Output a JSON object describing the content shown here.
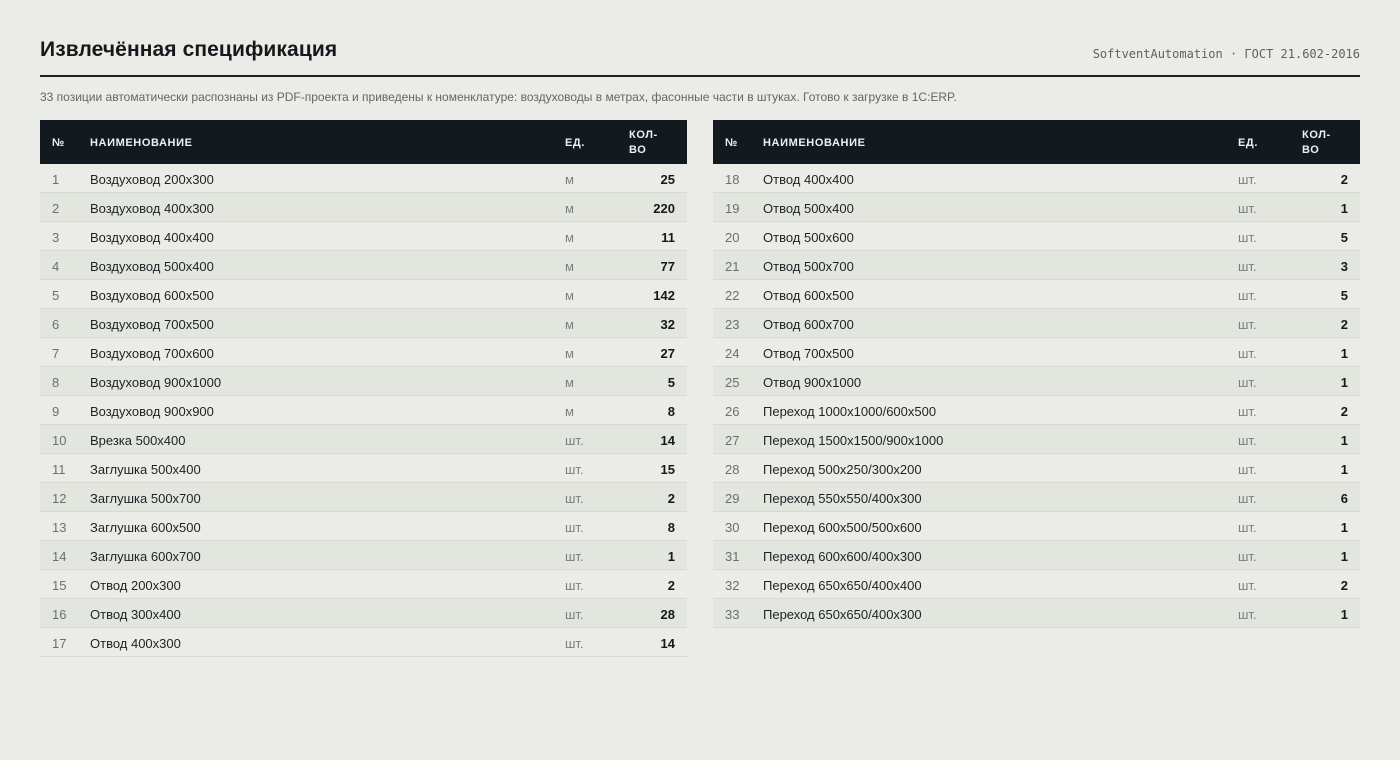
{
  "header": {
    "title": "Извлечённая спецификация",
    "meta": "SoftventAutomation · ГОСТ 21.602-2016"
  },
  "subtitle": "33 позиции автоматически распознаны из PDF-проекта и приведены к номенклатуре: воздуховоды в метрах, фасонные части в штуках. Готово к загрузке в 1С:ERP.",
  "columns": {
    "num": "№",
    "name": "НАИМЕНОВАНИЕ",
    "unit": "ЕД.",
    "qty": "КОЛ-ВО"
  },
  "left_rows": [
    {
      "num": "1",
      "name": "Воздуховод 200x300",
      "unit": "м",
      "qty": "25"
    },
    {
      "num": "2",
      "name": "Воздуховод 400x300",
      "unit": "м",
      "qty": "220"
    },
    {
      "num": "3",
      "name": "Воздуховод 400x400",
      "unit": "м",
      "qty": "11"
    },
    {
      "num": "4",
      "name": "Воздуховод 500x400",
      "unit": "м",
      "qty": "77"
    },
    {
      "num": "5",
      "name": "Воздуховод 600x500",
      "unit": "м",
      "qty": "142"
    },
    {
      "num": "6",
      "name": "Воздуховод 700x500",
      "unit": "м",
      "qty": "32"
    },
    {
      "num": "7",
      "name": "Воздуховод 700x600",
      "unit": "м",
      "qty": "27"
    },
    {
      "num": "8",
      "name": "Воздуховод 900x1000",
      "unit": "м",
      "qty": "5"
    },
    {
      "num": "9",
      "name": "Воздуховод 900x900",
      "unit": "м",
      "qty": "8"
    },
    {
      "num": "10",
      "name": "Врезка 500x400",
      "unit": "шт.",
      "qty": "14"
    },
    {
      "num": "11",
      "name": "Заглушка 500x400",
      "unit": "шт.",
      "qty": "15"
    },
    {
      "num": "12",
      "name": "Заглушка 500x700",
      "unit": "шт.",
      "qty": "2"
    },
    {
      "num": "13",
      "name": "Заглушка 600x500",
      "unit": "шт.",
      "qty": "8"
    },
    {
      "num": "14",
      "name": "Заглушка 600x700",
      "unit": "шт.",
      "qty": "1"
    },
    {
      "num": "15",
      "name": "Отвод 200x300",
      "unit": "шт.",
      "qty": "2"
    },
    {
      "num": "16",
      "name": "Отвод 300x400",
      "unit": "шт.",
      "qty": "28"
    },
    {
      "num": "17",
      "name": "Отвод 400x300",
      "unit": "шт.",
      "qty": "14"
    }
  ],
  "right_rows": [
    {
      "num": "18",
      "name": "Отвод 400x400",
      "unit": "шт.",
      "qty": "2"
    },
    {
      "num": "19",
      "name": "Отвод 500x400",
      "unit": "шт.",
      "qty": "1"
    },
    {
      "num": "20",
      "name": "Отвод 500x600",
      "unit": "шт.",
      "qty": "5"
    },
    {
      "num": "21",
      "name": "Отвод 500x700",
      "unit": "шт.",
      "qty": "3"
    },
    {
      "num": "22",
      "name": "Отвод 600x500",
      "unit": "шт.",
      "qty": "5"
    },
    {
      "num": "23",
      "name": "Отвод 600x700",
      "unit": "шт.",
      "qty": "2"
    },
    {
      "num": "24",
      "name": "Отвод 700x500",
      "unit": "шт.",
      "qty": "1"
    },
    {
      "num": "25",
      "name": "Отвод 900x1000",
      "unit": "шт.",
      "qty": "1"
    },
    {
      "num": "26",
      "name": "Переход 1000x1000/600x500",
      "unit": "шт.",
      "qty": "2"
    },
    {
      "num": "27",
      "name": "Переход 1500x1500/900x1000",
      "unit": "шт.",
      "qty": "1"
    },
    {
      "num": "28",
      "name": "Переход 500x250/300x200",
      "unit": "шт.",
      "qty": "1"
    },
    {
      "num": "29",
      "name": "Переход 550x550/400x300",
      "unit": "шт.",
      "qty": "6"
    },
    {
      "num": "30",
      "name": "Переход 600x500/500x600",
      "unit": "шт.",
      "qty": "1"
    },
    {
      "num": "31",
      "name": "Переход 600x600/400x300",
      "unit": "шт.",
      "qty": "1"
    },
    {
      "num": "32",
      "name": "Переход 650x650/400x400",
      "unit": "шт.",
      "qty": "2"
    },
    {
      "num": "33",
      "name": "Переход 650x650/400x300",
      "unit": "шт.",
      "qty": "1"
    }
  ]
}
